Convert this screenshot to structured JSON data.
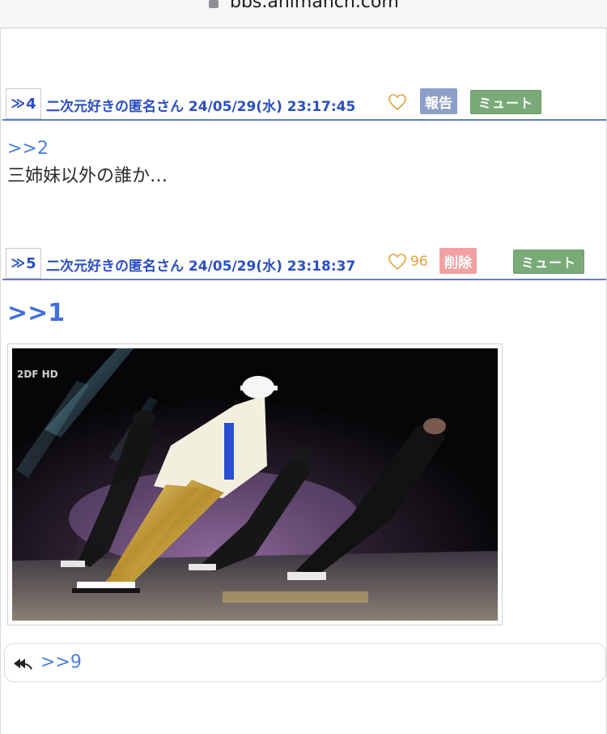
{
  "browser": {
    "url": "bbs.animanch.com"
  },
  "posts": [
    {
      "number": "4",
      "author": "二次元好きの匿名さん",
      "datetime": "24/05/29(水) 23:17:45",
      "likes": "",
      "action_label": "報告",
      "mute_label": "ミュート",
      "quote": ">>2",
      "text": "三姉妹以外の誰か…"
    },
    {
      "number": "5",
      "author": "二次元好きの匿名さん",
      "datetime": "24/05/29(水) 23:18:37",
      "likes": "96",
      "action_label": "削除",
      "mute_label": "ミュート",
      "quote": ">>1",
      "image": {
        "watermark": "2DF HD"
      }
    }
  ],
  "replies": {
    "link": ">>9"
  },
  "colors": {
    "accent_blue": "#2b4fc2",
    "link_blue": "#4a7ee0",
    "heart_orange": "#e0a23a",
    "report_bg": "#8b9fc9",
    "delete_bg": "#f1a1a1",
    "mute_bg": "#7aaa78",
    "divider": "#5b7fd1"
  }
}
